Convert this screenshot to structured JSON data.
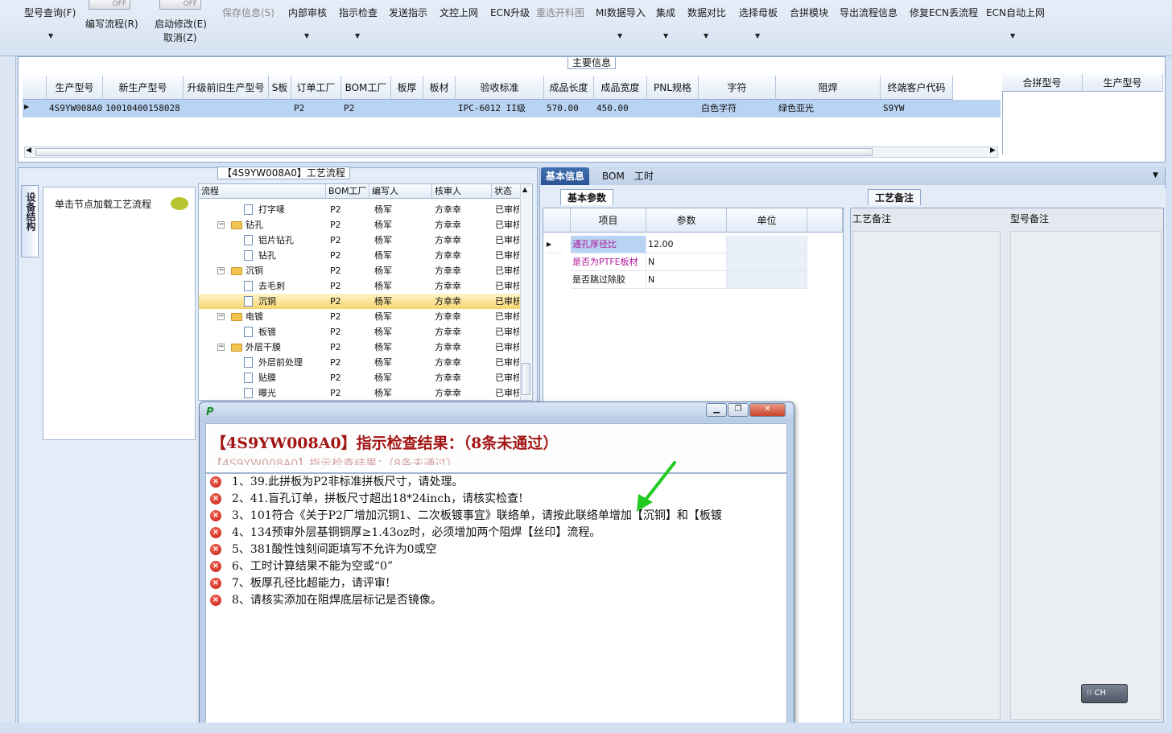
{
  "toolbar": {
    "items": [
      {
        "label": "型号查询(F)",
        "disabled": false,
        "dropdown": true
      },
      {
        "label": "编写流程(R)",
        "disabled": false,
        "dropdown": false
      },
      {
        "label": "启动修改(E)",
        "disabled": false,
        "dropdown": false
      },
      {
        "label": "取消(Z)",
        "disabled": false,
        "dropdown": false
      },
      {
        "label": "保存信息(S)",
        "disabled": true,
        "dropdown": false
      },
      {
        "label": "内部审核",
        "disabled": false,
        "dropdown": true
      },
      {
        "label": "指示检查",
        "disabled": false,
        "dropdown": true
      },
      {
        "label": "发送指示",
        "disabled": false,
        "dropdown": false
      },
      {
        "label": "文控上网",
        "disabled": false,
        "dropdown": false
      },
      {
        "label": "ECN升级",
        "disabled": false,
        "dropdown": false
      },
      {
        "label": "重选开料图",
        "disabled": true,
        "dropdown": false
      },
      {
        "label": "MI数据导入",
        "disabled": false,
        "dropdown": true
      },
      {
        "label": "集成",
        "disabled": false,
        "dropdown": true
      },
      {
        "label": "数据对比",
        "disabled": false,
        "dropdown": true
      },
      {
        "label": "选择母板",
        "disabled": false,
        "dropdown": true
      },
      {
        "label": "合拼模块",
        "disabled": false,
        "dropdown": false
      },
      {
        "label": "导出流程信息",
        "disabled": false,
        "dropdown": false
      },
      {
        "label": "修复ECN丢流程",
        "disabled": false,
        "dropdown": false
      },
      {
        "label": "ECN自动上网",
        "disabled": false,
        "dropdown": true
      }
    ],
    "toggle1": "OFF",
    "toggle2": "OFF"
  },
  "main_info": {
    "caption": "主要信息",
    "columns": [
      "生产型号",
      "新生产型号",
      "升级前旧生产型号",
      "S板",
      "订单工厂",
      "BOM工厂",
      "板厚",
      "板材",
      "验收标准",
      "成品长度",
      "成品宽度",
      "PNL规格",
      "字符",
      "阻焊",
      "终端客户代码"
    ],
    "row": [
      "4S9YW008A0",
      "10010400158028",
      "",
      "",
      "P2",
      "P2",
      "",
      "",
      "IPC-6012 II级",
      "570.00",
      "450.00",
      "",
      "白色字符",
      "绿色亚光",
      "S9YW"
    ],
    "combine_columns": [
      "合拼型号",
      "生产型号"
    ]
  },
  "left_tab": {
    "vertical_label": "设备结构",
    "click_hint": "单击节点加载工艺流程"
  },
  "process_flow": {
    "caption": "【4S9YW008A0】工艺流程",
    "columns": [
      "流程",
      "BOM工厂",
      "编写人",
      "核审人",
      "状态"
    ],
    "rows": [
      {
        "name": "打字唛",
        "level": 2,
        "type": "doc",
        "bom": "P2",
        "writer": "杨军",
        "reviewer": "方幸幸",
        "status": "已审核"
      },
      {
        "name": "钻孔",
        "level": 1,
        "type": "folder",
        "bom": "P2",
        "writer": "杨军",
        "reviewer": "方幸幸",
        "status": "已审核"
      },
      {
        "name": "铝片钻孔",
        "level": 2,
        "type": "doc",
        "bom": "P2",
        "writer": "杨军",
        "reviewer": "方幸幸",
        "status": "已审核"
      },
      {
        "name": "钻孔",
        "level": 2,
        "type": "doc",
        "bom": "P2",
        "writer": "杨军",
        "reviewer": "方幸幸",
        "status": "已审核"
      },
      {
        "name": "沉铜",
        "level": 1,
        "type": "folder",
        "bom": "P2",
        "writer": "杨军",
        "reviewer": "方幸幸",
        "status": "已审核"
      },
      {
        "name": "去毛刺",
        "level": 2,
        "type": "doc",
        "bom": "P2",
        "writer": "杨军",
        "reviewer": "方幸幸",
        "status": "已审核"
      },
      {
        "name": "沉铜",
        "level": 2,
        "type": "doc",
        "bom": "P2",
        "writer": "杨军",
        "reviewer": "方幸幸",
        "status": "已审核",
        "selected": true
      },
      {
        "name": "电镀",
        "level": 1,
        "type": "folder",
        "bom": "P2",
        "writer": "杨军",
        "reviewer": "方幸幸",
        "status": "已审核"
      },
      {
        "name": "板镀",
        "level": 2,
        "type": "doc",
        "bom": "P2",
        "writer": "杨军",
        "reviewer": "方幸幸",
        "status": "已审核"
      },
      {
        "name": "外层干膜",
        "level": 1,
        "type": "folder",
        "bom": "P2",
        "writer": "杨军",
        "reviewer": "方幸幸",
        "status": "已审核"
      },
      {
        "name": "外层前处理",
        "level": 2,
        "type": "doc",
        "bom": "P2",
        "writer": "杨军",
        "reviewer": "方幸幸",
        "status": "已审核"
      },
      {
        "name": "贴膜",
        "level": 2,
        "type": "doc",
        "bom": "P2",
        "writer": "杨军",
        "reviewer": "方幸幸",
        "status": "已审核"
      },
      {
        "name": "曝光",
        "level": 2,
        "type": "doc",
        "bom": "P2",
        "writer": "杨军",
        "reviewer": "方幸幸",
        "status": "已审核"
      }
    ]
  },
  "right_tabs": [
    "基本信息",
    "BOM",
    "工时"
  ],
  "basic_params": {
    "caption": "基本参数",
    "columns": [
      "项目",
      "参数",
      "单位"
    ],
    "rows": [
      {
        "item": "通孔厚径比",
        "value": "12.00",
        "unit": "",
        "highlight": true
      },
      {
        "item": "是否为PTFE板材",
        "value": "N",
        "unit": "",
        "highlight": true
      },
      {
        "item": "是否跳过除胶",
        "value": "N",
        "unit": "",
        "highlight": false
      }
    ]
  },
  "remarks": {
    "caption": "工艺备注",
    "col1": "工艺备注",
    "col2": "型号备注"
  },
  "dialog": {
    "title": "【4S9YW008A0】指示检查结果：（8条未通过）",
    "ghost": "【4S9YW008A0】指示检查结果：（8条未通过）",
    "errors": [
      "1、39.此拼板为P2非标准拼板尺寸，请处理。",
      "2、41.盲孔订单，拼板尺寸超出18*24inch，请核实检查!",
      "3、101符合《关于P2厂增加沉铜1、二次板镀事宜》联络单，请按此联络单增加【沉铜】和【板镀",
      "4、134预审外层基铜铜厚≥1.43oz时，必须增加两个阻焊【丝印】流程。",
      "5、381酸性蚀刻间距填写不允许为0或空",
      "6、工时计算结果不能为空或“0”",
      "7、板厚孔径比超能力，请评审!",
      "8、请核实添加在阻焊底层标记是否镜像。"
    ]
  },
  "ime": {
    "label": "CH"
  },
  "colors": {
    "accent": "#2a5595",
    "error": "#c41a10",
    "title_red": "#a31515",
    "selection": "#b9d3f2",
    "arrow": "#22cc22"
  }
}
